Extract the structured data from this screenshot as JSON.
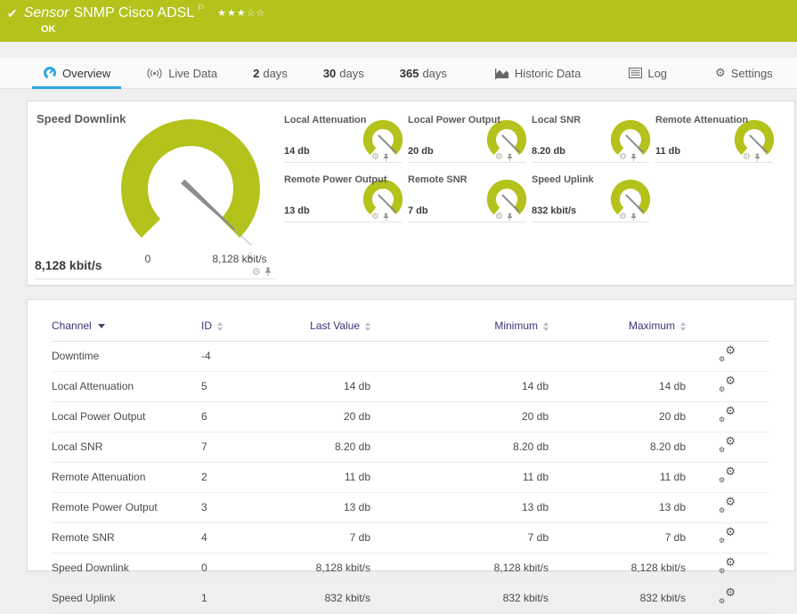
{
  "colors": {
    "header_bg": "#b4c21c",
    "accent_blue": "#2ea6df",
    "gauge_green": "#b4c21c",
    "needle_gray": "#8c8c8c",
    "table_header_text": "#3b3478"
  },
  "icons": {
    "check": "✔",
    "flag": "⚐",
    "stars_filled": "★★★",
    "stars_empty": "☆☆",
    "gear": "⚙",
    "mean_marker": "x̄"
  },
  "header": {
    "title_prefix": "Sensor",
    "title": "SNMP Cisco ADSL",
    "status": "OK",
    "rating": "3 of 5 stars"
  },
  "tabs": [
    {
      "label": "Overview",
      "active": true
    },
    {
      "label": "Live Data"
    },
    {
      "num": "2",
      "label": "days"
    },
    {
      "num": "30",
      "label": "days"
    },
    {
      "num": "365",
      "label": "days"
    },
    {
      "label": "Historic Data"
    },
    {
      "label": "Log"
    },
    {
      "label": "Settings"
    }
  ],
  "overview": {
    "main_gauge": {
      "title": "Speed Downlink",
      "value": "8,128 kbit/s",
      "scale_min": "0",
      "scale_max": "8,128 kbit/s"
    },
    "mini_gauges": [
      {
        "title": "Local Attenuation",
        "value": "14 db"
      },
      {
        "title": "Local Power Output",
        "value": "20 db"
      },
      {
        "title": "Local SNR",
        "value": "8.20 db"
      },
      {
        "title": "Remote Attenuation",
        "value": "11 db"
      },
      {
        "title": "Remote Power Output",
        "value": "13 db"
      },
      {
        "title": "Remote SNR",
        "value": "7 db"
      },
      {
        "title": "Speed Uplink",
        "value": "832 kbit/s"
      }
    ]
  },
  "table": {
    "columns": {
      "channel": "Channel",
      "id": "ID",
      "last": "Last Value",
      "min": "Minimum",
      "max": "Maximum"
    },
    "sorted_by": "Channel",
    "rows": [
      {
        "channel": "Downtime",
        "id": "-4",
        "last": "",
        "min": "",
        "max": ""
      },
      {
        "channel": "Local Attenuation",
        "id": "5",
        "last": "14 db",
        "min": "14 db",
        "max": "14 db"
      },
      {
        "channel": "Local Power Output",
        "id": "6",
        "last": "20 db",
        "min": "20 db",
        "max": "20 db"
      },
      {
        "channel": "Local SNR",
        "id": "7",
        "last": "8.20 db",
        "min": "8.20 db",
        "max": "8.20 db"
      },
      {
        "channel": "Remote Attenuation",
        "id": "2",
        "last": "11 db",
        "min": "11 db",
        "max": "11 db"
      },
      {
        "channel": "Remote Power Output",
        "id": "3",
        "last": "13 db",
        "min": "13 db",
        "max": "13 db"
      },
      {
        "channel": "Remote SNR",
        "id": "4",
        "last": "7 db",
        "min": "7 db",
        "max": "7 db"
      },
      {
        "channel": "Speed Downlink",
        "id": "0",
        "last": "8,128 kbit/s",
        "min": "8,128 kbit/s",
        "max": "8,128 kbit/s"
      },
      {
        "channel": "Speed Uplink",
        "id": "1",
        "last": "832 kbit/s",
        "min": "832 kbit/s",
        "max": "832 kbit/s"
      }
    ]
  }
}
